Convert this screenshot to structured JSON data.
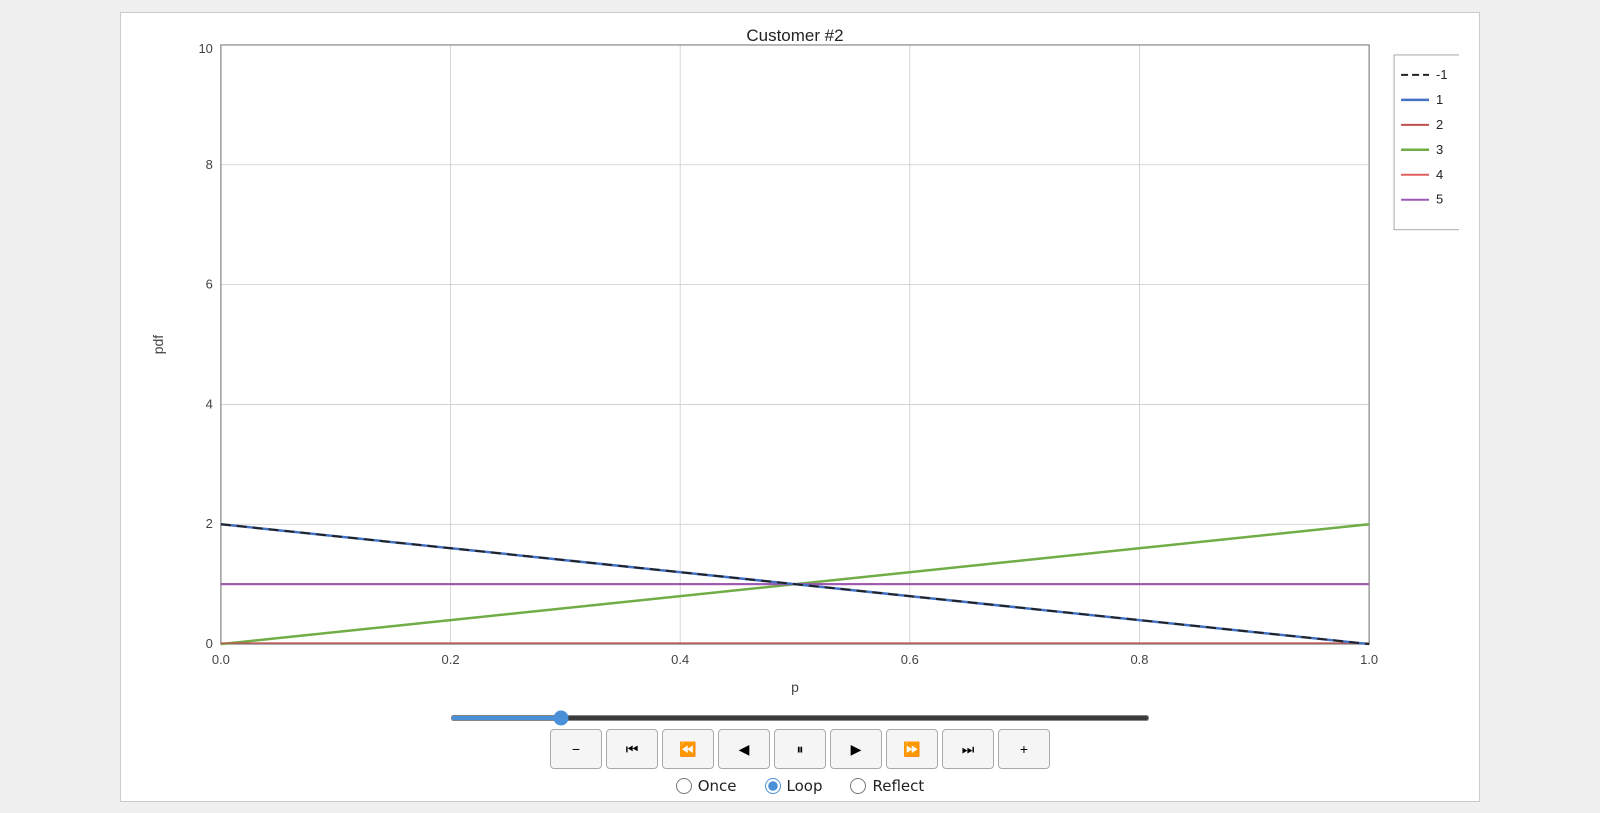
{
  "chart": {
    "title": "Customer #2",
    "x_label": "p",
    "y_label": "pdf",
    "x_min": 0.0,
    "x_max": 1.0,
    "y_min": 0,
    "y_max": 10,
    "x_ticks": [
      "0.0",
      "0.2",
      "0.4",
      "0.6",
      "0.8",
      "1.0"
    ],
    "y_ticks": [
      "0",
      "2",
      "4",
      "6",
      "8",
      "10"
    ],
    "legend": [
      {
        "label": "-1",
        "color": "#222222",
        "dash": true
      },
      {
        "label": "1",
        "color": "#4472c4",
        "dash": false
      },
      {
        "label": "2",
        "color": "#c0504d",
        "dash": false
      },
      {
        "label": "3",
        "color": "#70ad47",
        "dash": false
      },
      {
        "label": "4",
        "color": "#e06060",
        "dash": false
      },
      {
        "label": "5",
        "color": "#9b59b6",
        "dash": false
      }
    ]
  },
  "controls": {
    "slider_value": 15,
    "slider_min": 0,
    "slider_max": 100,
    "buttons": [
      {
        "label": "−",
        "name": "minus-button"
      },
      {
        "label": "⏮",
        "name": "skip-back-button"
      },
      {
        "label": "⏭",
        "name": "step-back-button"
      },
      {
        "label": "◀",
        "name": "back-button"
      },
      {
        "label": "⏸",
        "name": "pause-button"
      },
      {
        "label": "▶",
        "name": "play-button"
      },
      {
        "label": "⏭",
        "name": "step-forward-button"
      },
      {
        "label": "⏭",
        "name": "skip-forward-button"
      },
      {
        "label": "+",
        "name": "plus-button"
      }
    ],
    "radio_options": [
      {
        "label": "Once",
        "value": "once",
        "checked": false
      },
      {
        "label": "Loop",
        "value": "loop",
        "checked": true
      },
      {
        "label": "Reflect",
        "value": "reflect",
        "checked": false
      }
    ]
  }
}
